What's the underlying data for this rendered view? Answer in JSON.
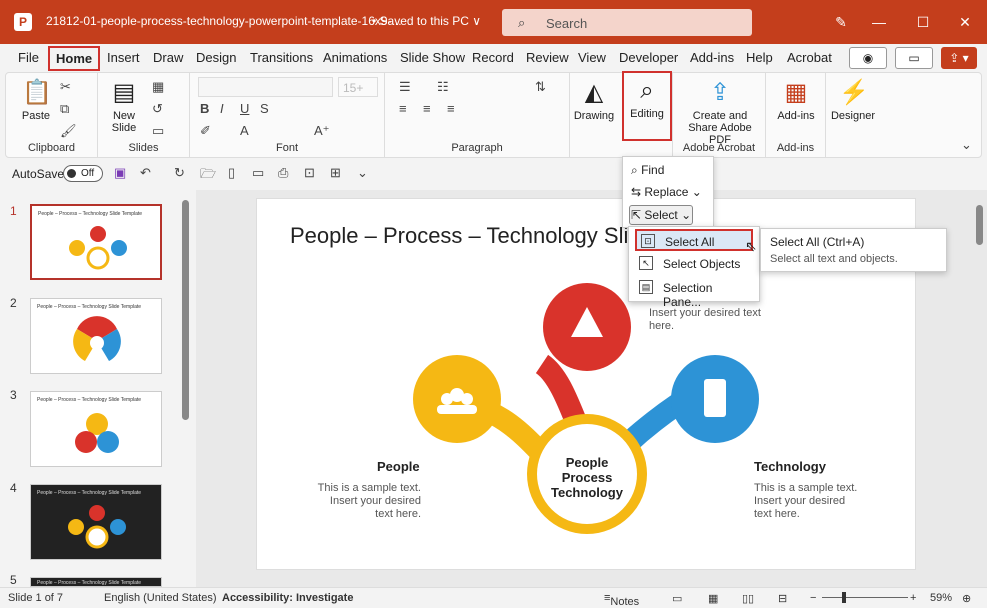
{
  "titlebar": {
    "filename": "21812-01-people-process-technology-powerpoint-template-16x9-...",
    "saved": "•  Saved to this PC ∨",
    "search_placeholder": "Search"
  },
  "tabs": [
    "File",
    "Home",
    "Insert",
    "Draw",
    "Design",
    "Transitions",
    "Animations",
    "Slide Show",
    "Record",
    "Review",
    "View",
    "Developer",
    "Add-ins",
    "Help",
    "Acrobat"
  ],
  "ribbon": {
    "paste": "Paste",
    "clipboard": "Clipboard",
    "new_slide": "New Slide",
    "slides": "Slides",
    "font_size": "15+",
    "font": "Font",
    "paragraph": "Paragraph",
    "drawing": "Drawing",
    "editing": "Editing",
    "acrobat_btn": "Create and Share Adobe PDF",
    "adobe_acrobat": "Adobe Acrobat",
    "addins_btn": "Add-ins",
    "addins_group": "Add-ins",
    "designer": "Designer"
  },
  "qat": {
    "autosave": "AutoSave",
    "toggle": "Off"
  },
  "editing_menu": {
    "find": "Find",
    "replace": "Replace",
    "select": "Select"
  },
  "select_submenu": {
    "select_all": "Select All",
    "select_objects": "Select Objects",
    "selection_pane": "Selection Pane..."
  },
  "tooltip": {
    "title": "Select All (Ctrl+A)",
    "desc": "Select all text and objects."
  },
  "thumbnails": [
    {
      "num": "1",
      "title": "People – Process – Technology Slide Template"
    },
    {
      "num": "2",
      "title": "People – Process – Technology Slide Template"
    },
    {
      "num": "3",
      "title": "People – Process – Technology Slide Template"
    },
    {
      "num": "4",
      "title": "People – Process – Technology Slide Template"
    },
    {
      "num": "5",
      "title": "People – Process – Technology Slide Template"
    }
  ],
  "slide": {
    "title": "People – Process – Technology Sli...",
    "center": [
      "People",
      "Process",
      "Technology"
    ],
    "people_label": "People",
    "tech_label": "Technology",
    "sample": [
      "This is a sample text.",
      "Insert your desired",
      "text here."
    ],
    "process_sample": [
      "Insert your desired text",
      "here."
    ],
    "colors": {
      "red": "#d9332b",
      "yellow": "#f5b814",
      "blue": "#2d93d6",
      "accent": "#c43e1c"
    }
  },
  "status": {
    "slide": "Slide 1 of 7",
    "lang": "English (United States)",
    "access": "Accessibility: Investigate",
    "notes": "Notes",
    "zoom": "59%"
  }
}
